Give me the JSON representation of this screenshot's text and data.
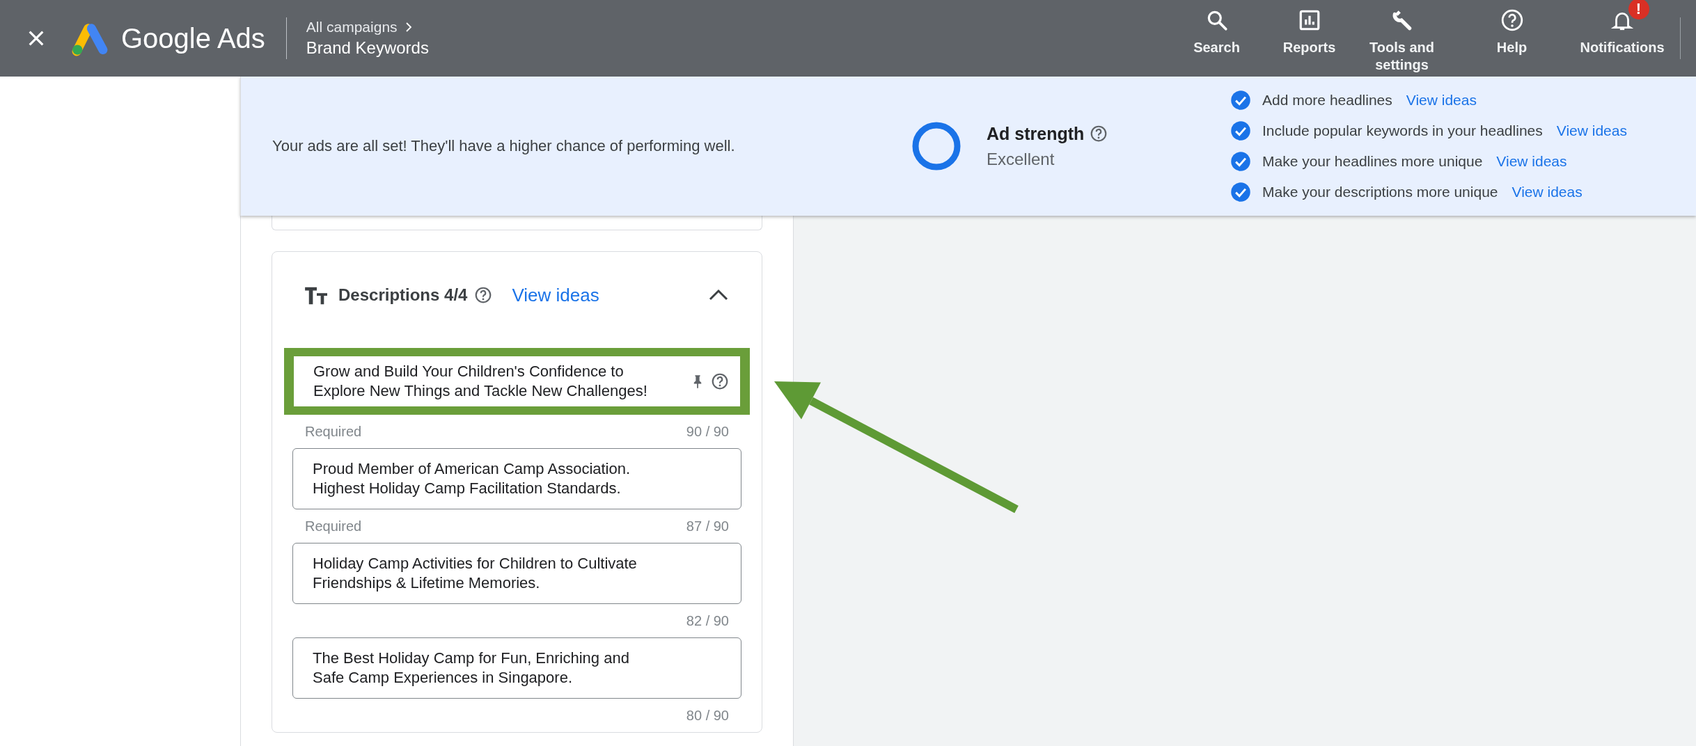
{
  "top_bar": {
    "title": "Google Ads",
    "breadcrumb": "All campaigns",
    "page": "Brand Keywords",
    "nav": [
      {
        "label": "Search",
        "kind": "search"
      },
      {
        "label": "Reports",
        "kind": "reports"
      },
      {
        "label": "Tools and settings",
        "kind": "tools"
      },
      {
        "label": "Help",
        "kind": "help"
      },
      {
        "label": "Notifications",
        "kind": "notifications",
        "alert": "!"
      }
    ]
  },
  "banner": {
    "message": "Your ads are all set! They'll have a higher chance of performing well.",
    "ad_strength": {
      "label": "Ad strength",
      "rating": "Excellent",
      "level": 1
    },
    "checklist": [
      {
        "text": "Add more headlines",
        "checked": true,
        "link": "View ideas"
      },
      {
        "text": "Include popular keywords in your headlines",
        "checked": true,
        "link": "View ideas"
      },
      {
        "text": "Make your headlines more unique",
        "checked": true,
        "link": "View ideas"
      },
      {
        "text": "Make your descriptions more unique",
        "checked": true,
        "link": "View ideas"
      }
    ]
  },
  "descriptions": {
    "title": "Descriptions 4/4",
    "link": "View ideas",
    "expanded": true,
    "items": [
      {
        "text": "Grow and Build Your Children's Confidence to Explore New Things and Tackle New Challenges!",
        "helper": "Required",
        "count": "90 / 90",
        "highlighted": true,
        "hovered": true
      },
      {
        "text": "Proud Member of American Camp Association. Highest Holiday Camp Facilitation Standards.",
        "helper": "Required",
        "count": "87 / 90",
        "highlighted": false,
        "hovered": false
      },
      {
        "text": "Holiday Camp Activities for Children to Cultivate Friendships & Lifetime Memories.",
        "count": "82 / 90",
        "highlighted": false,
        "hovered": false
      },
      {
        "text": "The Best Holiday Camp for Fun, Enriching and Safe Camp Experiences in Singapore.",
        "count": "80 / 90",
        "highlighted": false,
        "hovered": false
      }
    ]
  }
}
